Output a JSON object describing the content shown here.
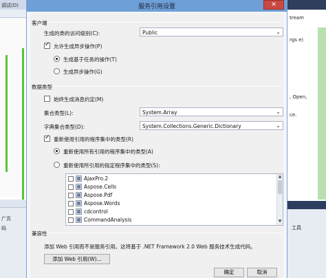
{
  "background": {
    "left_top_text": "调试(D)",
    "left_panel_text": "广页",
    "left_panel_text2": "码",
    "right_top_text": "tream",
    "right_text1": "rgs e)",
    "right_text2": ", Open,",
    "right_text3": "ce.",
    "right_panel_text": "工具"
  },
  "dialog": {
    "title": "服务引用设置",
    "close_glyph": "✕",
    "client_section": "客户端",
    "access_level_label": "生成的类的访问级别(C):",
    "access_level_value": "Public",
    "async_label": "允许生成异步操作(P)",
    "task_based_label": "生成基于任务的操作(T)",
    "async_ops_label": "生成异步操作(G)",
    "data_type_section": "数据类型",
    "always_generate_label": "始终生成消息约定(M)",
    "collection_type_label": "集合类型(L):",
    "collection_type_value": "System.Array",
    "dictionary_type_label": "字典集合类型(D):",
    "dictionary_type_value": "System.Collections.Generic.Dictionary",
    "reuse_types_label": "重新使用引用的程序集中的类型(R)",
    "reuse_all_label": "重新使用所有引用的程序集中的类型(A)",
    "reuse_specified_label": "重新使用所引用的指定程序集中的类型(S):",
    "assemblies": [
      "AjaxPro.2",
      "Aspose.Cells",
      "Aspose.Pdf",
      "Aspose.Words",
      "cdcontrol",
      "CommandAnalysis"
    ],
    "compat_section": "兼容性",
    "compat_text": "添加 Web 引用而不是服务引用。这将基于 .NET Framework 2.0 Web 服务技术生成代码。",
    "add_web_ref_button": "添加 Web 引用(W)...",
    "ok_button": "确定",
    "cancel_button": "取消",
    "dropdown_arrow": "⌄",
    "scroll_up": "▲",
    "scroll_down": "▼"
  }
}
